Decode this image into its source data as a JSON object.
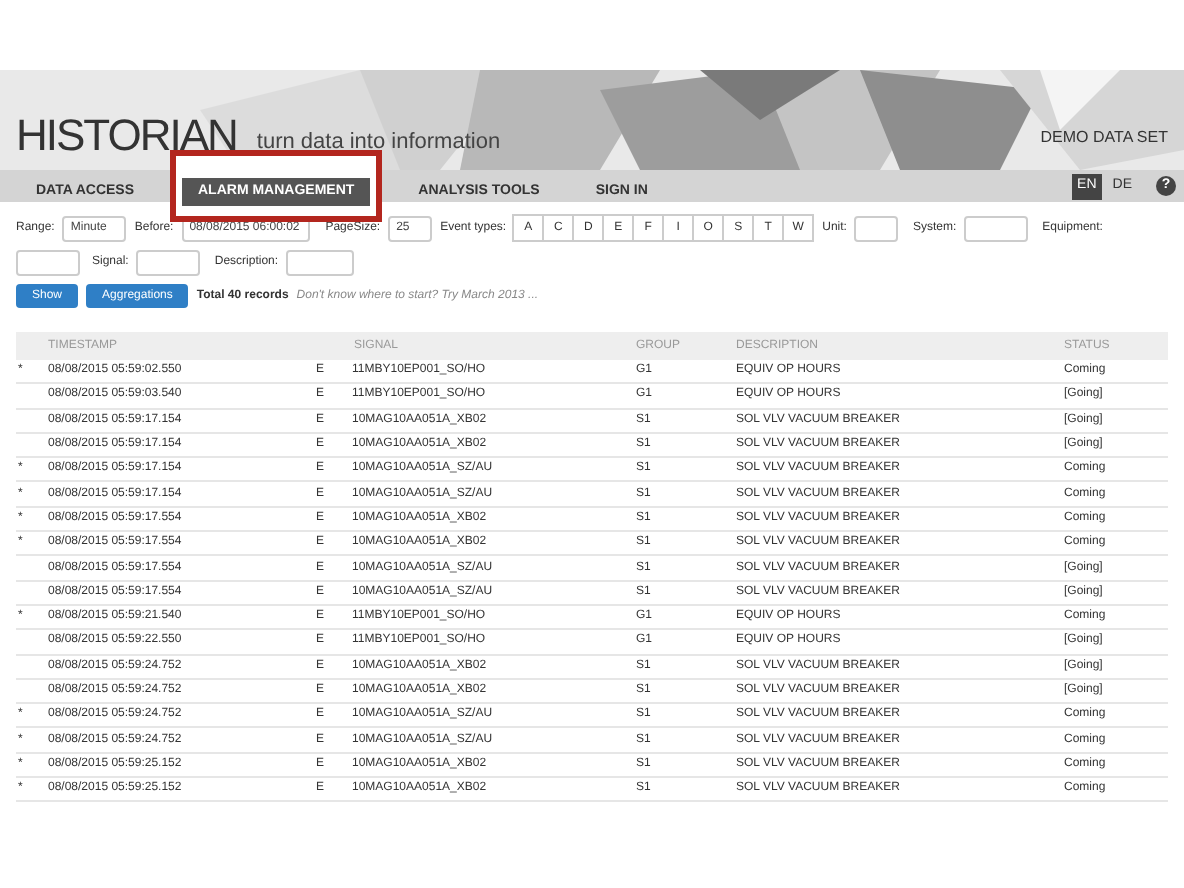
{
  "header": {
    "logo": "HISTORIAN",
    "tagline": "turn data into information",
    "dataset": "DEMO DATA SET"
  },
  "nav": {
    "items": [
      {
        "label": "DATA ACCESS",
        "selected": false,
        "highlighted": false
      },
      {
        "label": "ALARM MANAGEMENT",
        "selected": true,
        "highlighted": true
      },
      {
        "label": "ANALYSIS TOOLS",
        "selected": false,
        "highlighted": false
      },
      {
        "label": "SIGN IN",
        "selected": false,
        "highlighted": false
      }
    ],
    "languages": [
      {
        "label": "EN",
        "selected": true
      },
      {
        "label": "DE",
        "selected": false
      }
    ],
    "help": "?"
  },
  "filters": {
    "range_label": "Range:",
    "range_value": "Minute",
    "before_label": "Before:",
    "before_value": "08/08/2015 06:00:02",
    "pagesize_label": "PageSize:",
    "pagesize_value": "25",
    "event_types_label": "Event types:",
    "event_types": [
      {
        "label": "A",
        "selected": false
      },
      {
        "label": "C",
        "selected": false
      },
      {
        "label": "D",
        "selected": false
      },
      {
        "label": "E",
        "selected": false
      },
      {
        "label": "F",
        "selected": false
      },
      {
        "label": "I",
        "selected": false
      },
      {
        "label": "O",
        "selected": false
      },
      {
        "label": "S",
        "selected": false
      },
      {
        "label": "T",
        "selected": false
      },
      {
        "label": "W",
        "selected": false
      }
    ],
    "unit_label": "Unit:",
    "system_label": "System:",
    "equipment_label": "Equipment:",
    "signal_label": "Signal:",
    "description_label": "Description:"
  },
  "actions": {
    "buttons": [
      "Show",
      "Aggregations"
    ],
    "total": "Total 40 records",
    "hint": "Don't know where to start? Try March 2013 ..."
  },
  "table": {
    "columns": [
      "TIMESTAMP",
      "SIGNAL",
      "GROUP",
      "DESCRIPTION",
      "STATUS"
    ],
    "rows": [
      {
        "flag": "*",
        "timestamp": "08/08/2015 05:59:02.550",
        "type": "E",
        "signal": "11MBY10EP001_SO/HO",
        "group": "G1",
        "description": "EQUIV OP HOURS",
        "status": "Coming"
      },
      {
        "timestamp": "08/08/2015 05:59:03.540",
        "type": "E",
        "signal": "11MBY10EP001_SO/HO",
        "group": "G1",
        "description": "EQUIV OP HOURS",
        "status": "[Going]"
      },
      {
        "timestamp": "08/08/2015 05:59:17.154",
        "type": "E",
        "signal": "10MAG10AA051A_XB02",
        "group": "S1",
        "description": "SOL VLV VACUUM BREAKER",
        "status": "[Going]"
      },
      {
        "timestamp": "08/08/2015 05:59:17.154",
        "type": "E",
        "signal": "10MAG10AA051A_XB02",
        "group": "S1",
        "description": "SOL VLV VACUUM BREAKER",
        "status": "[Going]"
      },
      {
        "flag": "*",
        "timestamp": "08/08/2015 05:59:17.154",
        "type": "E",
        "signal": "10MAG10AA051A_SZ/AU",
        "group": "S1",
        "description": "SOL VLV VACUUM BREAKER",
        "status": "Coming"
      },
      {
        "flag": "*",
        "timestamp": "08/08/2015 05:59:17.154",
        "type": "E",
        "signal": "10MAG10AA051A_SZ/AU",
        "group": "S1",
        "description": "SOL VLV VACUUM BREAKER",
        "status": "Coming"
      },
      {
        "flag": "*",
        "timestamp": "08/08/2015 05:59:17.554",
        "type": "E",
        "signal": "10MAG10AA051A_XB02",
        "group": "S1",
        "description": "SOL VLV VACUUM BREAKER",
        "status": "Coming"
      },
      {
        "flag": "*",
        "timestamp": "08/08/2015 05:59:17.554",
        "type": "E",
        "signal": "10MAG10AA051A_XB02",
        "group": "S1",
        "description": "SOL VLV VACUUM BREAKER",
        "status": "Coming"
      },
      {
        "timestamp": "08/08/2015 05:59:17.554",
        "type": "E",
        "signal": "10MAG10AA051A_SZ/AU",
        "group": "S1",
        "description": "SOL VLV VACUUM BREAKER",
        "status": "[Going]"
      },
      {
        "timestamp": "08/08/2015 05:59:17.554",
        "type": "E",
        "signal": "10MAG10AA051A_SZ/AU",
        "group": "S1",
        "description": "SOL VLV VACUUM BREAKER",
        "status": "[Going]"
      },
      {
        "flag": "*",
        "timestamp": "08/08/2015 05:59:21.540",
        "type": "E",
        "signal": "11MBY10EP001_SO/HO",
        "group": "G1",
        "description": "EQUIV OP HOURS",
        "status": "Coming"
      },
      {
        "timestamp": "08/08/2015 05:59:22.550",
        "type": "E",
        "signal": "11MBY10EP001_SO/HO",
        "group": "G1",
        "description": "EQUIV OP HOURS",
        "status": "[Going]"
      },
      {
        "timestamp": "08/08/2015 05:59:24.752",
        "type": "E",
        "signal": "10MAG10AA051A_XB02",
        "group": "S1",
        "description": "SOL VLV VACUUM BREAKER",
        "status": "[Going]"
      },
      {
        "timestamp": "08/08/2015 05:59:24.752",
        "type": "E",
        "signal": "10MAG10AA051A_XB02",
        "group": "S1",
        "description": "SOL VLV VACUUM BREAKER",
        "status": "[Going]"
      },
      {
        "flag": "*",
        "timestamp": "08/08/2015 05:59:24.752",
        "type": "E",
        "signal": "10MAG10AA051A_SZ/AU",
        "group": "S1",
        "description": "SOL VLV VACUUM BREAKER",
        "status": "Coming"
      },
      {
        "flag": "*",
        "timestamp": "08/08/2015 05:59:24.752",
        "type": "E",
        "signal": "10MAG10AA051A_SZ/AU",
        "group": "S1",
        "description": "SOL VLV VACUUM BREAKER",
        "status": "Coming"
      },
      {
        "flag": "*",
        "timestamp": "08/08/2015 05:59:25.152",
        "type": "E",
        "signal": "10MAG10AA051A_XB02",
        "group": "S1",
        "description": "SOL VLV VACUUM BREAKER",
        "status": "Coming"
      },
      {
        "flag": "*",
        "timestamp": "08/08/2015 05:59:25.152",
        "type": "E",
        "signal": "10MAG10AA051A_XB02",
        "group": "S1",
        "description": "SOL VLV VACUUM BREAKER",
        "status": "Coming"
      }
    ]
  }
}
